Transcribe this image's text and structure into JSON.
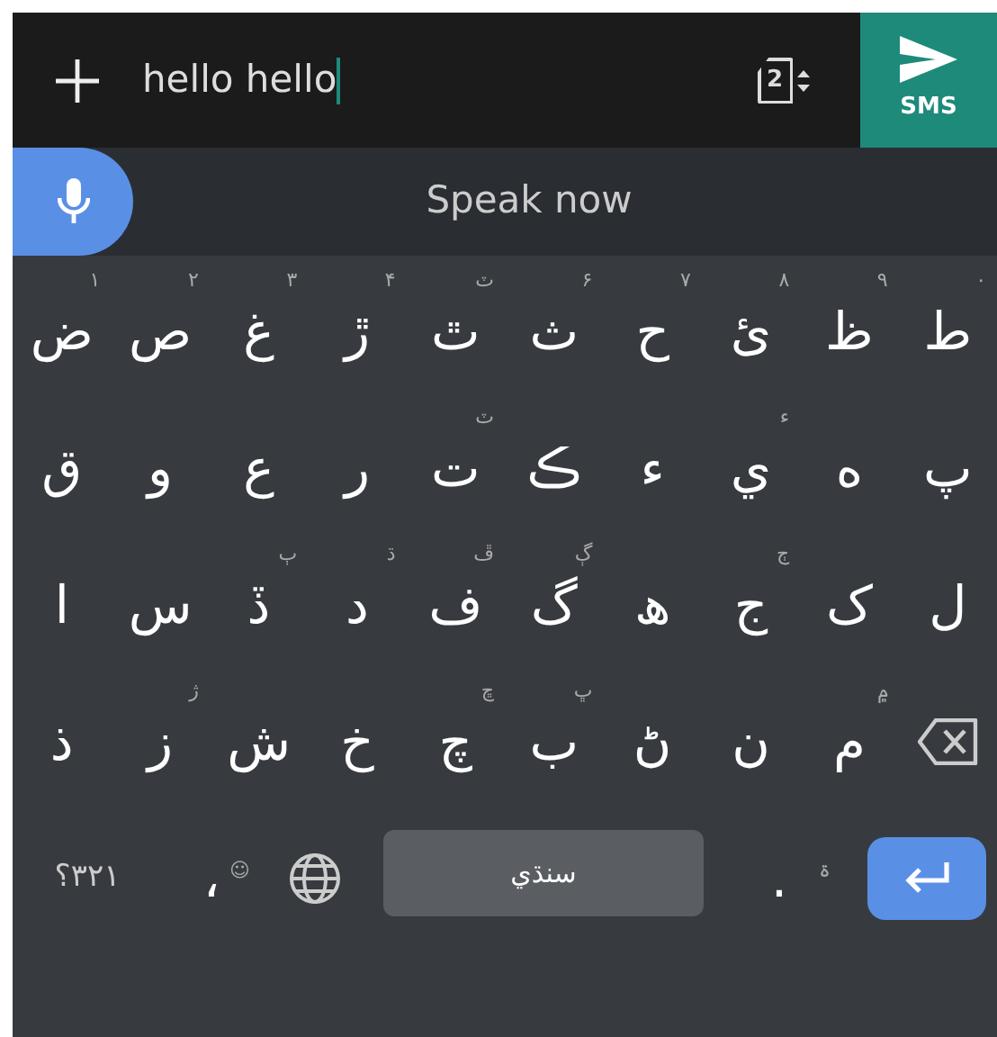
{
  "compose": {
    "text": "hello hello",
    "sim_slot": "2",
    "send_label": "SMS"
  },
  "voice": {
    "prompt": "Speak now"
  },
  "keyboard": {
    "rows": [
      [
        {
          "kind": "letter",
          "label": "ط",
          "hint": "۰"
        },
        {
          "kind": "letter",
          "label": "ظ",
          "hint": "۹"
        },
        {
          "kind": "letter",
          "label": "ئ",
          "hint": "۸"
        },
        {
          "kind": "letter",
          "label": "ح",
          "hint": "۷"
        },
        {
          "kind": "letter",
          "label": "ث",
          "hint": "۶"
        },
        {
          "kind": "letter",
          "label": "ٿ",
          "hint": "ٽ"
        },
        {
          "kind": "letter",
          "label": "ڙ",
          "hint": "۴"
        },
        {
          "kind": "letter",
          "label": "غ",
          "hint": "۳"
        },
        {
          "kind": "letter",
          "label": "ص",
          "hint": "۲"
        },
        {
          "kind": "letter",
          "label": "ض",
          "hint": "۱"
        }
      ],
      [
        {
          "kind": "letter",
          "label": "پ"
        },
        {
          "kind": "letter",
          "label": "ه"
        },
        {
          "kind": "letter",
          "label": "ي",
          "hint": "ء"
        },
        {
          "kind": "letter",
          "label": "ء"
        },
        {
          "kind": "letter",
          "label": "ڪ"
        },
        {
          "kind": "letter",
          "label": "ت",
          "hint": "ٽ"
        },
        {
          "kind": "letter",
          "label": "ر"
        },
        {
          "kind": "letter",
          "label": "ع"
        },
        {
          "kind": "letter",
          "label": "و"
        },
        {
          "kind": "letter",
          "label": "ق"
        }
      ],
      [
        {
          "kind": "letter",
          "label": "ل"
        },
        {
          "kind": "letter",
          "label": "ک"
        },
        {
          "kind": "letter",
          "label": "ج",
          "hint": "ڄ"
        },
        {
          "kind": "letter",
          "label": "ھ"
        },
        {
          "kind": "letter",
          "label": "گ",
          "hint": "ڳ"
        },
        {
          "kind": "letter",
          "label": "ف",
          "hint": "ڦ"
        },
        {
          "kind": "letter",
          "label": "د",
          "hint": "ڌ"
        },
        {
          "kind": "letter",
          "label": "ڏ",
          "hint": "ٻ"
        },
        {
          "kind": "letter",
          "label": "س"
        },
        {
          "kind": "letter",
          "label": "ا"
        }
      ],
      [
        {
          "kind": "backspace"
        },
        {
          "kind": "letter",
          "label": "م",
          "hint": "۾"
        },
        {
          "kind": "letter",
          "label": "ن"
        },
        {
          "kind": "letter",
          "label": "ڻ"
        },
        {
          "kind": "letter",
          "label": "ب",
          "hint": "ڀ"
        },
        {
          "kind": "letter",
          "label": "چ",
          "hint": "ڇ"
        },
        {
          "kind": "letter",
          "label": "خ"
        },
        {
          "kind": "letter",
          "label": "ش"
        },
        {
          "kind": "letter",
          "label": "ز",
          "hint": "ژ"
        },
        {
          "kind": "letter",
          "label": "ذ"
        }
      ]
    ],
    "bottom_row": [
      {
        "kind": "enter"
      },
      {
        "kind": "letter",
        "label": ".",
        "hint": "ۃ"
      },
      {
        "kind": "space",
        "label": "سنڌي"
      },
      {
        "kind": "globe"
      },
      {
        "kind": "letter",
        "label": "،",
        "hint": "☺"
      },
      {
        "kind": "symbols",
        "label": "؟۳۲۱"
      }
    ]
  }
}
